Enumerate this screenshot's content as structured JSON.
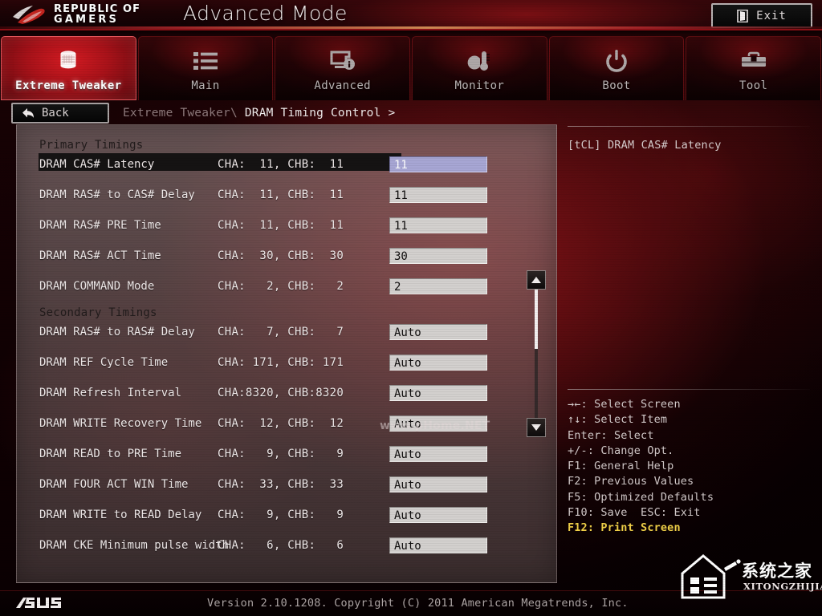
{
  "titlebar": {
    "brand_line1": "REPUBLIC OF",
    "brand_line2": "GAMERS",
    "mode_title": "Advanced Mode",
    "exit_label": "Exit"
  },
  "tabs": [
    {
      "label": "Extreme Tweaker",
      "icon": "overclock-icon",
      "active": true
    },
    {
      "label": "Main",
      "icon": "list-icon",
      "active": false
    },
    {
      "label": "Advanced",
      "icon": "monitor-info-icon",
      "active": false
    },
    {
      "label": "Monitor",
      "icon": "thermometer-icon",
      "active": false
    },
    {
      "label": "Boot",
      "icon": "power-icon",
      "active": false
    },
    {
      "label": "Tool",
      "icon": "toolbox-icon",
      "active": false
    }
  ],
  "navrow": {
    "back_label": "Back",
    "breadcrumb_parent": "Extreme Tweaker\\",
    "breadcrumb_current": "DRAM Timing Control",
    "breadcrumb_suffix": ">"
  },
  "settings": {
    "groups": [
      {
        "title": "Primary Timings",
        "rows": [
          {
            "label": "DRAM CAS# Latency",
            "channels": "CHA:  11, CHB:  11",
            "value": "11",
            "selected": true
          },
          {
            "label": "DRAM RAS# to CAS# Delay",
            "channels": "CHA:  11, CHB:  11",
            "value": "11",
            "selected": false
          },
          {
            "label": "DRAM RAS# PRE Time",
            "channels": "CHA:  11, CHB:  11",
            "value": "11",
            "selected": false
          },
          {
            "label": "DRAM RAS# ACT Time",
            "channels": "CHA:  30, CHB:  30",
            "value": "30",
            "selected": false
          },
          {
            "label": "DRAM COMMAND Mode",
            "channels": "CHA:   2, CHB:   2",
            "value": "2",
            "selected": false
          }
        ]
      },
      {
        "title": "Secondary Timings",
        "rows": [
          {
            "label": "DRAM RAS# to RAS# Delay",
            "channels": "CHA:   7, CHB:   7",
            "value": "Auto",
            "selected": false
          },
          {
            "label": "DRAM REF Cycle Time",
            "channels": "CHA: 171, CHB: 171",
            "value": "Auto",
            "selected": false
          },
          {
            "label": "DRAM Refresh Interval",
            "channels": "CHA:8320, CHB:8320",
            "value": "Auto",
            "selected": false
          },
          {
            "label": "DRAM WRITE Recovery Time",
            "channels": "CHA:  12, CHB:  12",
            "value": "Auto",
            "selected": false
          },
          {
            "label": "DRAM READ to PRE Time",
            "channels": "CHA:   9, CHB:   9",
            "value": "Auto",
            "selected": false
          },
          {
            "label": "DRAM FOUR ACT WIN Time",
            "channels": "CHA:  33, CHB:  33",
            "value": "Auto",
            "selected": false
          },
          {
            "label": "DRAM WRITE to READ Delay",
            "channels": "CHA:   9, CHB:   9",
            "value": "Auto",
            "selected": false
          },
          {
            "label": "DRAM CKE Minimum pulse width",
            "channels": "CHA:   6, CHB:   6",
            "value": "Auto",
            "selected": false
          }
        ]
      }
    ],
    "watermark": "www.pHome.NET"
  },
  "help": {
    "text": "[tCL] DRAM CAS# Latency"
  },
  "legend": {
    "lines": [
      {
        "text": "→←: Select Screen",
        "highlight": false
      },
      {
        "text": "↑↓: Select Item",
        "highlight": false
      },
      {
        "text": "Enter: Select",
        "highlight": false
      },
      {
        "text": "+/-: Change Opt.",
        "highlight": false
      },
      {
        "text": "F1: General Help",
        "highlight": false
      },
      {
        "text": "F2: Previous Values",
        "highlight": false
      },
      {
        "text": "F5: Optimized Defaults",
        "highlight": false
      },
      {
        "text": "F10: Save  ESC: Exit",
        "highlight": false
      },
      {
        "text": "F12: Print Screen",
        "highlight": true
      }
    ]
  },
  "footer": {
    "version": "Version 2.10.1208. Copyright (C) 2011 American Megatrends, Inc.",
    "brand": "ASUS"
  },
  "watermark_corner": {
    "cn": "系统之家",
    "en": "XITONGZHIJIA.NET"
  },
  "colors": {
    "accent_red": "#b4282c",
    "selected_field": "#a7a6d4",
    "field_gray": "#d3d0ce",
    "legend_highlight": "#f0d048"
  }
}
